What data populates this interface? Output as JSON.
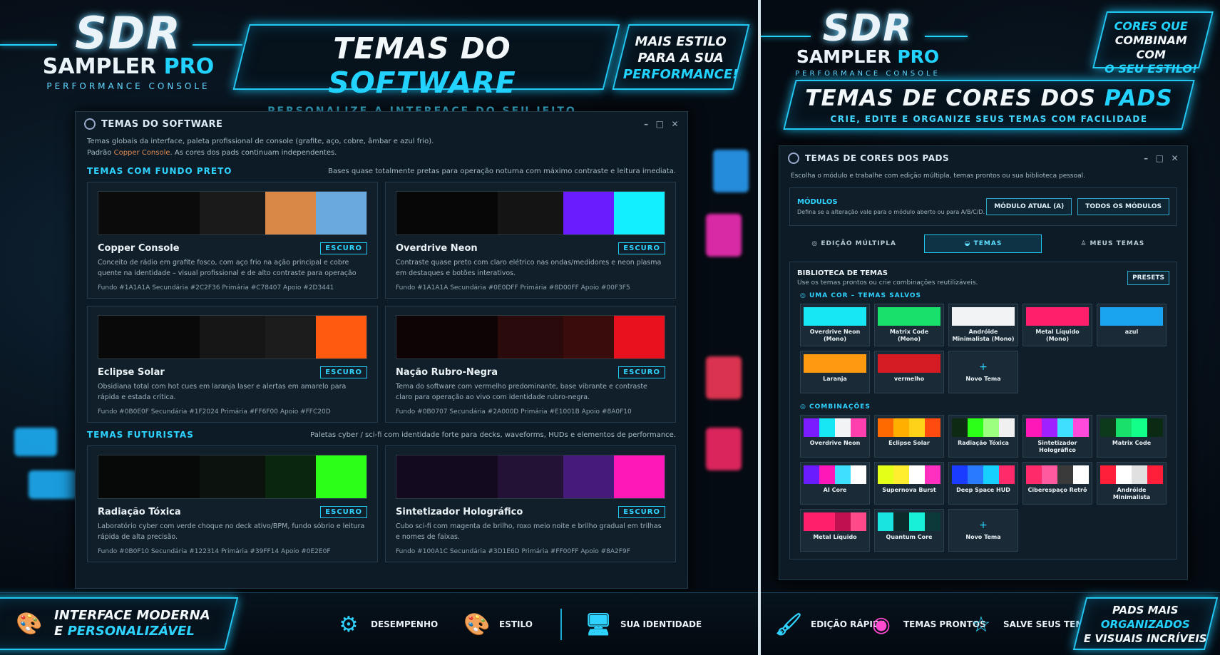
{
  "left": {
    "logo": {
      "sdr": "SDR",
      "sampler": "SAMPLER",
      "pro": "PRO",
      "sub": "PERFORMANCE CONSOLE"
    },
    "banner": {
      "t1": "TEMAS DO",
      "t2": "SOFTWARE",
      "sub": "PERSONALIZE A INTERFACE DO SEU JEITO"
    },
    "promo": {
      "l1": "MAIS ESTILO",
      "l2": "PARA A SUA",
      "l3": "PERFORMANCE!"
    },
    "window": {
      "title": "TEMAS DO SOFTWARE",
      "desc1": "Temas globais da interface, paleta profissional de console (grafite, aço, cobre, âmbar e azul frio).",
      "desc2a": "Padrão ",
      "desc2b": "Copper Console",
      "desc2c": ". As cores dos pads continuam independentes."
    },
    "sec1": {
      "h": "TEMAS COM FUNDO PRETO",
      "d": "Bases quase totalmente pretas para operação noturna com máximo contraste e leitura imediata."
    },
    "sec2": {
      "h": "TEMAS FUTURISTAS",
      "d": "Paletas cyber / sci-fi com identidade forte para decks, waveforms, HUDs e elementos de performance."
    },
    "cards": [
      {
        "name": "Copper Console",
        "badge": "ESCURO",
        "desc": "Conceito de rádio em grafite fosco, com aço frio na ação principal e cobre quente na identidade – visual profissional e de alto contraste para operação prolongada.",
        "hex": "Fundo #1A1A1A   Secundária #2C2F36   Primária #C78407   Apoio #2D3441",
        "colors": [
          "#0b0b0b",
          "#0b0b0b",
          "#1a1a1a",
          "#d98848",
          "#6aa9dd"
        ]
      },
      {
        "name": "Overdrive Neon",
        "badge": "ESCURO",
        "desc": "Contraste quase preto com claro elétrico nas ondas/medidores e neon plasma em destaques e botões interativos.",
        "hex": "Fundo #1A1A1A   Secundária #0E0DFF   Primária #8D00FF   Apoio #00F3F5",
        "colors": [
          "#070707",
          "#070707",
          "#141414",
          "#6a1cff",
          "#12f0ff"
        ]
      },
      {
        "name": "Eclipse Solar",
        "badge": "ESCURO",
        "desc": "Obsidiana total com hot cues em laranja laser e alertas em amarelo para rápida e estada crítica.",
        "hex": "Fundo #0B0E0F   Secundária #1F2024   Primária #FF6F00   Apoio #FFC20D",
        "colors": [
          "#090909",
          "#090909",
          "#161616",
          "#1c1c1c",
          "#ff5a10"
        ]
      },
      {
        "name": "Nação Rubro-Negra",
        "badge": "ESCURO",
        "desc": "Tema do software com vermelho predominante, base vibrante e contraste claro para operação ao vivo com identidade rubro-negra.",
        "hex": "Fundo #0B0707   Secundária #2A000D   Primária #E1001B   Apoio #8A0F10",
        "colors": [
          "#0f0405",
          "#0f0405",
          "#2a0a0b",
          "#3a0c0c",
          "#e8111d"
        ]
      },
      {
        "name": "Radiação Tóxica",
        "badge": "ESCURO",
        "desc": "Laboratório cyber com verde choque no deck ativo/BPM, fundo sóbrio e leitura rápida de alta precisão.",
        "hex": "Fundo #0B0F10   Secundária #122314   Primária #39FF14   Apoio #0E2E0F",
        "colors": [
          "#060908",
          "#060908",
          "#0c120e",
          "#0b260f",
          "#2cff18"
        ]
      },
      {
        "name": "Sintetizador Holográfico",
        "badge": "ESCURO",
        "desc": "Cubo sci-fi com magenta de brilho, roxo meio noite e brilho gradual em trilhas e nomes de faixas.",
        "hex": "Fundo #100A1C   Secundária #3D1E6D   Primária #FF00FF   Apoio #8A2F9F",
        "colors": [
          "#140a20",
          "#140a20",
          "#241236",
          "#451a78",
          "#ff18b8"
        ]
      }
    ],
    "features": [
      {
        "icon": "palette-icon",
        "glyph": "🎨",
        "l1": "INTERFACE MODERNA",
        "l2a": "E ",
        "l2b": "PERSONALIZÁVEL"
      },
      {
        "icon": "gear-icon",
        "glyph": "⚙",
        "label": "DESEMPENHO"
      },
      {
        "icon": "palette-icon",
        "glyph": "🎨",
        "label": "ESTILO"
      },
      {
        "icon": "monitor-icon",
        "glyph": "🖥",
        "label": "SUA IDENTIDADE"
      }
    ]
  },
  "right": {
    "logo": {
      "sdr": "SDR",
      "sampler": "SAMPLER",
      "pro": "PRO",
      "sub": "PERFORMANCE CONSOLE"
    },
    "promo": {
      "l1": "CORES QUE",
      "l2": "COMBINAM COM",
      "l3": "O SEU ESTILO!"
    },
    "banner": {
      "t1": "TEMAS DE CORES DOS",
      "t2": "PADS",
      "sub": "CRIE, EDITE E ORGANIZE SEUS TEMAS COM FACILIDADE"
    },
    "window": {
      "title": "TEMAS DE CORES DOS PADS",
      "desc": "Escolha o módulo e trabalhe com edição múltipla, temas prontos ou sua biblioteca pessoal."
    },
    "modulos": {
      "t": "MÓDULOS",
      "s": "Defina se a alteração vale para o módulo aberto ou para A/B/C/D.",
      "b1": "MÓDULO ATUAL (A)",
      "b2": "TODOS OS MÓDULOS"
    },
    "tabs": [
      "EDIÇÃO MÚLTIPLA",
      "TEMAS",
      "MEUS TEMAS"
    ],
    "lib": {
      "h": "BIBLIOTECA DE TEMAS",
      "s": "Use os temas prontos ou crie combinações reutilizáveis.",
      "presets": "PRESETS",
      "sub1": "UMA COR – TEMAS SALVOS",
      "sub2": "COMBINAÇÕES"
    },
    "pads1": [
      {
        "label": "Overdrive Neon (Mono)",
        "colors": [
          "#17e6f5"
        ]
      },
      {
        "label": "Matrix Code (Mono)",
        "colors": [
          "#18e06a"
        ]
      },
      {
        "label": "Andróide Minimalista (Mono)",
        "colors": [
          "#f1f3f5"
        ]
      },
      {
        "label": "Metal Líquido (Mono)",
        "colors": [
          "#ff1f6a"
        ]
      },
      {
        "label": "azul",
        "colors": [
          "#1aa3ef"
        ]
      },
      {
        "label": "Laranja",
        "colors": [
          "#ff9a10"
        ]
      },
      {
        "label": "vermelho",
        "colors": [
          "#d51c25"
        ]
      }
    ],
    "pads2": [
      {
        "label": "Overdrive Neon",
        "colors": [
          "#7a1cff",
          "#17e6f5",
          "#f1f3f5",
          "#ff3fae"
        ]
      },
      {
        "label": "Eclipse Solar",
        "colors": [
          "#ff6a00",
          "#ffaf00",
          "#ffd21a",
          "#ff4a10"
        ]
      },
      {
        "label": "Radiação Tóxica",
        "colors": [
          "#0f2a12",
          "#2cff18",
          "#9cff80",
          "#f0f0f0"
        ]
      },
      {
        "label": "Sintetizador Holográfico",
        "colors": [
          "#ff18b8",
          "#a020ff",
          "#3fe0ff",
          "#ff4adc"
        ]
      },
      {
        "label": "Matrix Code",
        "colors": [
          "#0c3a1a",
          "#18e06a",
          "#12ff8a",
          "#0a2a14"
        ]
      },
      {
        "label": "AI Core",
        "colors": [
          "#6a1cff",
          "#ff18b8",
          "#3fe0ff",
          "#ffffff"
        ]
      },
      {
        "label": "Supernova Burst",
        "colors": [
          "#e4ff18",
          "#ffee30",
          "#ffffff",
          "#ff30c0"
        ]
      },
      {
        "label": "Deep Space HUD",
        "colors": [
          "#1a3cff",
          "#2a7aff",
          "#18d0ff",
          "#ff2a6a"
        ]
      },
      {
        "label": "Ciberespaço Retrô",
        "colors": [
          "#ff2a6a",
          "#ff5aa0",
          "#3a3a3a",
          "#ffffff"
        ]
      },
      {
        "label": "Andróide Minimalista",
        "colors": [
          "#ff1f3a",
          "#ffffff",
          "#e0e0e0",
          "#ff1f3a"
        ]
      },
      {
        "label": "Metal Líquido",
        "colors": [
          "#ff1f6a",
          "#ff1f6a",
          "#c01050",
          "#ff4a8a"
        ]
      },
      {
        "label": "Quantum Core",
        "colors": [
          "#1ae4e0",
          "#0c2a2a",
          "#18f0d8",
          "#0c3a3a"
        ]
      }
    ],
    "newTheme": "Novo Tema",
    "features": [
      {
        "icon": "brush-icon",
        "glyph": "🖌",
        "label": "EDIÇÃO RÁPIDA"
      },
      {
        "icon": "color-wheel-icon",
        "glyph": "◉",
        "label": "TEMAS PRONTOS"
      },
      {
        "icon": "star-icon",
        "glyph": "☆",
        "label": "SALVE SEUS TEMAS"
      }
    ],
    "bigf": {
      "l1": "PADS MAIS",
      "l2": "ORGANIZADOS",
      "l3": "E VISUAIS INCRÍVEIS"
    }
  }
}
